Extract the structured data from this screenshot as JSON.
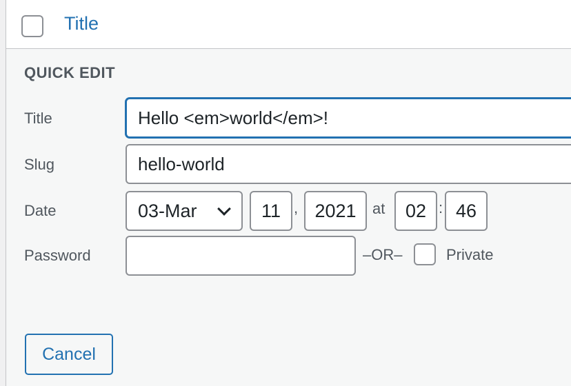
{
  "header": {
    "column_title": "Title"
  },
  "quick_edit": {
    "section_title": "QUICK EDIT",
    "title": {
      "label": "Title",
      "value": "Hello <em>world</em>!"
    },
    "slug": {
      "label": "Slug",
      "value": "hello-world"
    },
    "date": {
      "label": "Date",
      "month": "03-Mar",
      "day": "11",
      "comma": ",",
      "year": "2021",
      "at": "at",
      "hour": "02",
      "colon": ":",
      "minute": "46"
    },
    "password": {
      "label": "Password",
      "value": "",
      "or_text": "–OR–",
      "private_label": "Private"
    },
    "cancel_label": "Cancel"
  },
  "colors": {
    "accent": "#2271b1",
    "label_text": "#50575e",
    "panel_background": "#f6f7f7",
    "border": "#8c8f94"
  },
  "icons": {
    "month_dropdown": "chevron-down-icon"
  }
}
